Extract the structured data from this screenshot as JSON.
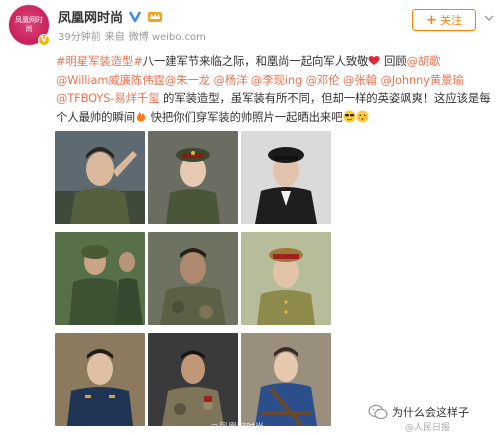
{
  "header": {
    "name": "凤凰网时尚",
    "avatar_text": "凤凰网时尚",
    "time": "39分钟前",
    "source_prefix": "来自",
    "source": "微博 weibo.com",
    "follow_label": "关注"
  },
  "post": {
    "hashtag": "#明星军装造型#",
    "intro": "八一建军节来临之际，和凰尚一起向军人致敬",
    "review": " 回顾",
    "mentions": [
      "@胡歌",
      "@William威廉陈伟霆",
      "@朱一龙",
      "@杨洋",
      "@李现ing",
      "@邓伦",
      "@张翰",
      "@Johnny黄景瑜",
      "@TFBOYS-易烊千玺"
    ],
    "body1": " 的军装造型，虽军装有所不同，但却一样的英姿飒爽！这应该是每个人最帅的瞬间",
    "body2": " 快把你们穿军装的帅照片一起晒出来吧"
  },
  "footer": {
    "watermark_left": "@凤凰网时尚",
    "wechat_label": "为什么会这样子",
    "watermark_right": "@人民日报"
  },
  "colors": {
    "accent": "#ff8200",
    "link": "#eb7350",
    "brand": "#c81f5a"
  }
}
